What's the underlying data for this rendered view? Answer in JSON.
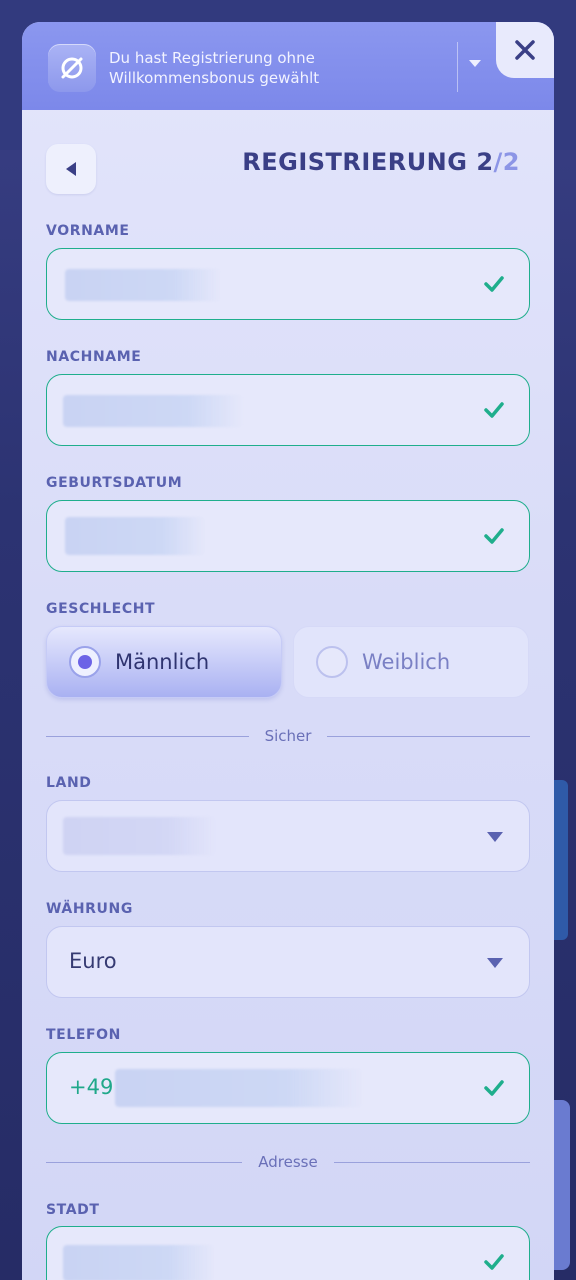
{
  "banner": {
    "text": "Du hast Registrierung ohne Willkommensbonus gewählt",
    "icon": "no-bonus-icon"
  },
  "header": {
    "title": "REGISTRIERUNG 2",
    "total": "/2"
  },
  "fields": {
    "vorname": {
      "label": "VORNAME"
    },
    "nachname": {
      "label": "NACHNAME"
    },
    "geburtsdatum": {
      "label": "GEBURTSDATUM"
    },
    "geschlecht": {
      "label": "GESCHLECHT",
      "options": [
        "Männlich",
        "Weiblich"
      ],
      "selected": "Männlich"
    },
    "land": {
      "label": "LAND"
    },
    "waehrung": {
      "label": "WÄHRUNG",
      "value": "Euro"
    },
    "telefon": {
      "label": "TELEFON",
      "prefix": "+49"
    },
    "stadt": {
      "label": "STADT"
    }
  },
  "separators": {
    "secure": "Sicher",
    "address": "Adresse"
  },
  "colors": {
    "accent": "#1fae8c",
    "banner": "#7c88ea",
    "title": "#3a3f86",
    "label": "#5a62b0"
  }
}
